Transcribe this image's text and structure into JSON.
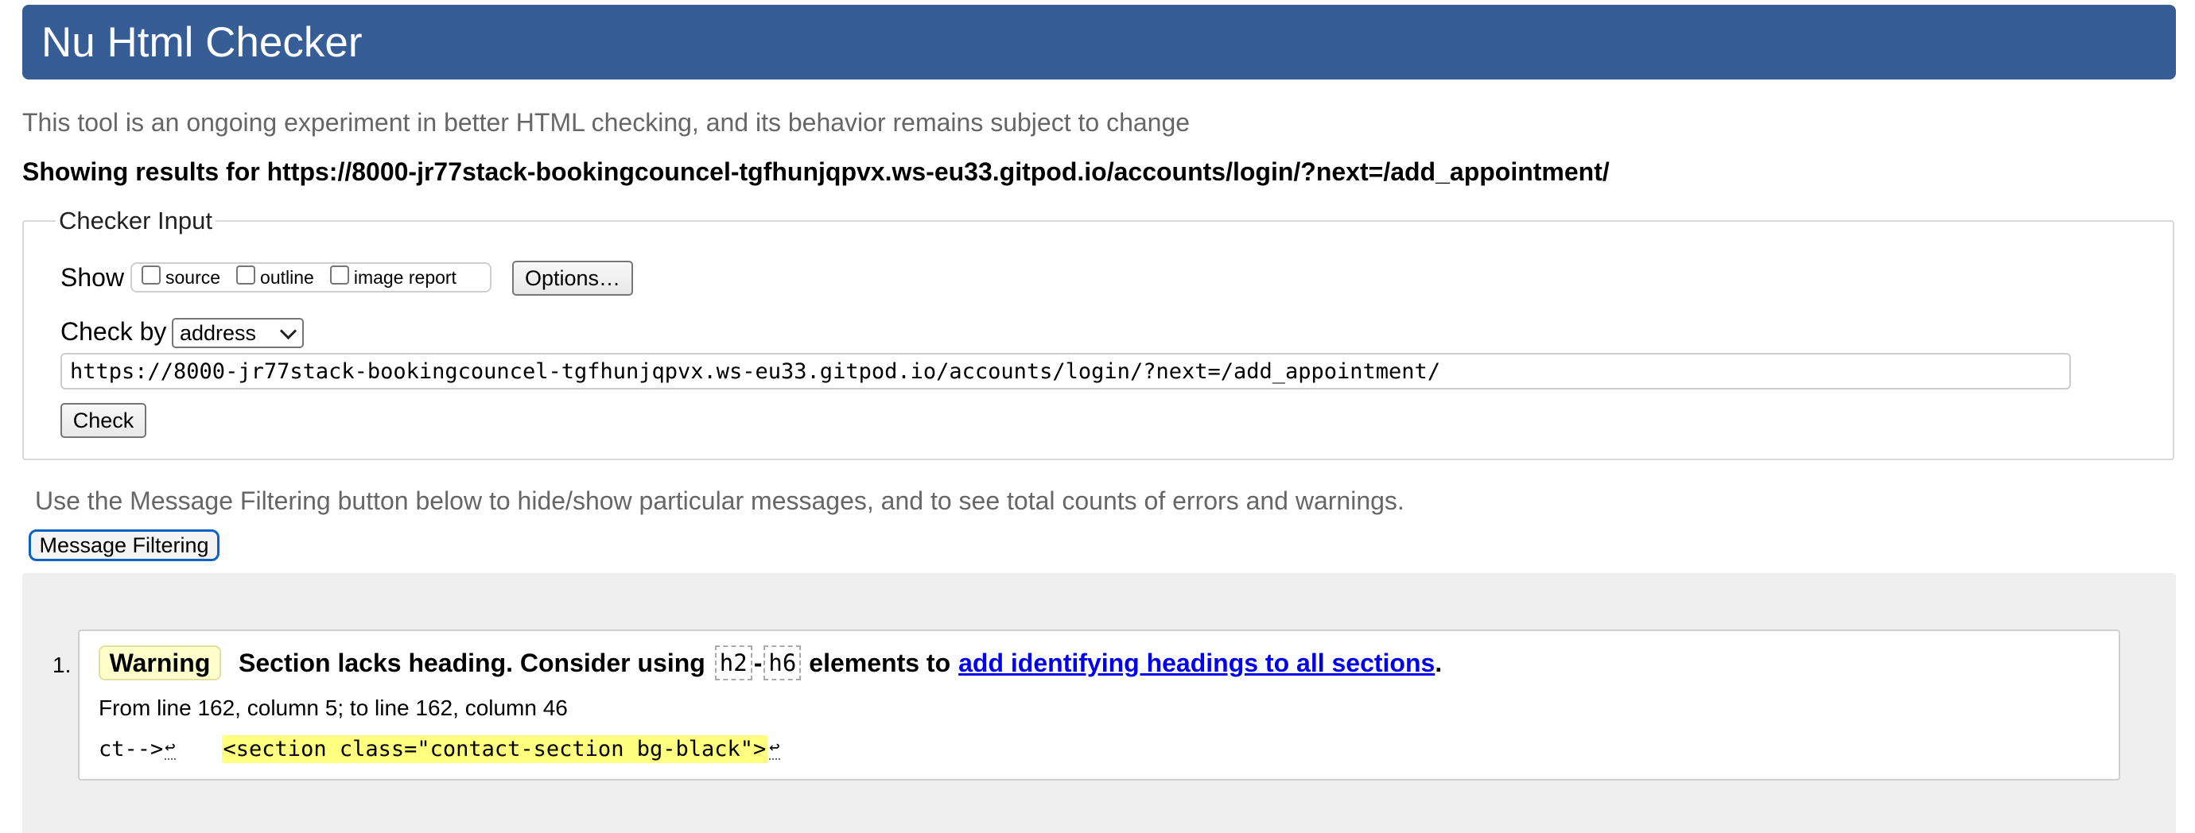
{
  "header": {
    "title": "Nu Html Checker"
  },
  "intro": "This tool is an ongoing experiment in better HTML checking, and its behavior remains subject to change",
  "results_title": "Showing results for https://8000-jr77stack-bookingcouncel-tgfhunjqpvx.ws-eu33.gitpod.io/accounts/login/?next=/add_appointment/",
  "checker_input": {
    "legend": "Checker Input",
    "show_label": "Show",
    "show_options": [
      "source",
      "outline",
      "image report"
    ],
    "options_button": "Options…",
    "check_by_label": "Check by",
    "check_by_value": "address",
    "url_value": "https://8000-jr77stack-bookingcouncel-tgfhunjqpvx.ws-eu33.gitpod.io/accounts/login/?next=/add_appointment/",
    "check_button": "Check"
  },
  "filter_note": "Use the Message Filtering button below to hide/show particular messages, and to see total counts of errors and warnings.",
  "filter_button": "Message Filtering",
  "messages": [
    {
      "number": "1.",
      "type": "Warning",
      "text_before": "Section lacks heading. Consider using",
      "code1": "h2",
      "dash": "-",
      "code2": "h6",
      "text_middle": "elements to",
      "link_text": "add identifying headings to all sections",
      "text_end": ".",
      "location": "From line 162, column 5; to line 162, column 46",
      "extract_before": "ct-->",
      "extract_lf": "↩",
      "extract_highlight": "<section class=\"contact-section bg-black\">",
      "extract_after_lf": "↩"
    }
  ],
  "colors": {
    "header_bg": "#365d95",
    "warning_bg": "#ffffcc",
    "highlight_bg": "#ffff80",
    "link": "#0000ee",
    "focus_ring": "#0b62c4"
  }
}
